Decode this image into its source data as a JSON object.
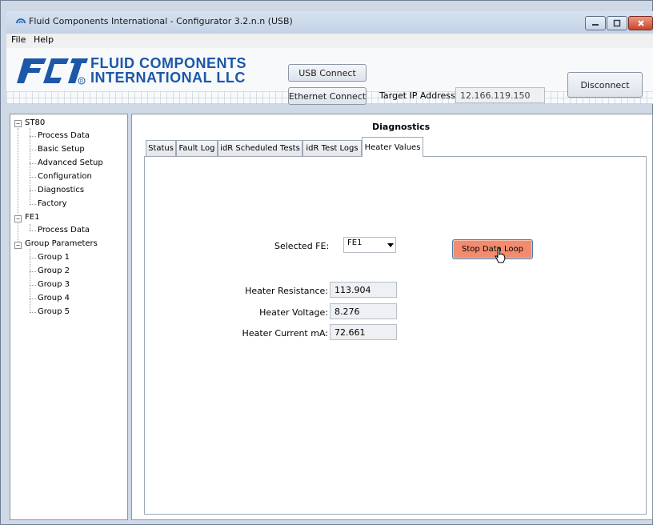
{
  "window": {
    "title": "Fluid Components International - Configurator 3.2.n.n (USB)",
    "controls": {
      "minimize": "minimize-icon",
      "maximize": "maximize-icon",
      "close": "close-icon"
    }
  },
  "menu": [
    "File",
    "Help"
  ],
  "header": {
    "logo_mark": "FCI",
    "logo_line1": "FLUID COMPONENTS",
    "logo_line2": "INTERNATIONAL LLC",
    "usb_connect": "USB Connect",
    "ethernet_connect": "Ethernet Connect",
    "target_ip_label": "Target IP Address:",
    "target_ip_value": "12.166.119.150",
    "disconnect": "Disconnect"
  },
  "tree": {
    "root1": "ST80",
    "root1_children": [
      "Process Data",
      "Basic Setup",
      "Advanced Setup",
      "Configuration",
      "Diagnostics",
      "Factory"
    ],
    "root2": "FE1",
    "root2_children": [
      "Process Data"
    ],
    "root3": "Group Parameters",
    "root3_children": [
      "Group 1",
      "Group 2",
      "Group 3",
      "Group 4",
      "Group 5"
    ]
  },
  "main": {
    "title": "Diagnostics",
    "tabs": [
      "Status",
      "Fault Log",
      "idR Scheduled Tests",
      "idR Test Logs",
      "Heater Values"
    ],
    "active_tab": "Heater Values",
    "selected_fe_label": "Selected FE:",
    "selected_fe_value": "FE1",
    "stop_button": "Stop Data Loop",
    "fields": [
      {
        "label": "Heater Resistance:",
        "value": "113.904"
      },
      {
        "label": "Heater Voltage:",
        "value": "8.276"
      },
      {
        "label": "Heater Current mA:",
        "value": "72.661"
      }
    ]
  },
  "colors": {
    "logo_blue": "#1d57a8",
    "stop_button": "#f38c6e",
    "close_button": "#c8432b"
  }
}
